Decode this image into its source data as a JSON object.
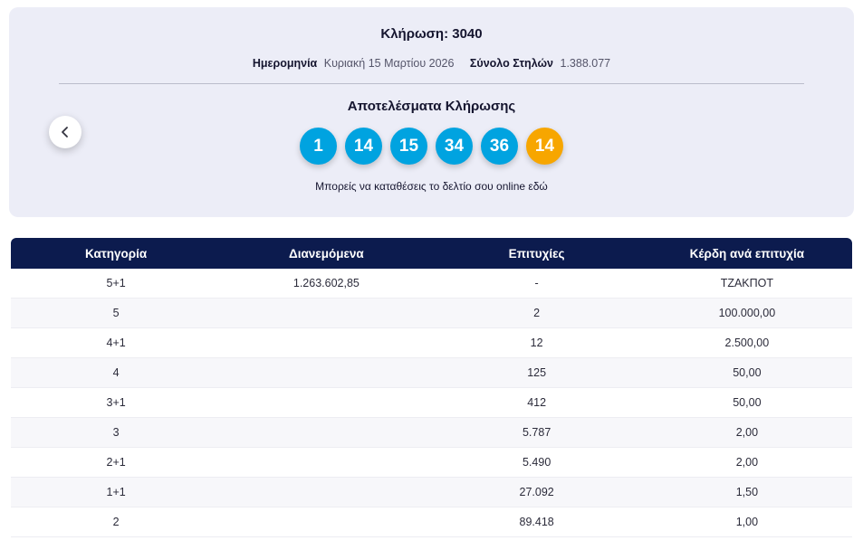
{
  "draw": {
    "title_label": "Κλήρωση:",
    "title_value": "3040",
    "date_label": "Ημερομηνία",
    "date_value": "Κυριακή 15 Μαρτίου 2026",
    "columns_label": "Σύνολο Στηλών",
    "columns_value": "1.388.077",
    "results_title": "Αποτελέσματα Κλήρωσης",
    "numbers": [
      "1",
      "14",
      "15",
      "34",
      "36"
    ],
    "bonus_number": "14",
    "online_text": "Μπορείς να καταθέσεις το δελτίο σου online εδώ"
  },
  "colors": {
    "card_bg": "#ecedf7",
    "number_circle": "#00a3e0",
    "bonus_circle": "#f7a600",
    "table_header_bg": "#0c1b4e"
  },
  "table": {
    "headers": [
      "Κατηγορία",
      "Διανεμόμενα",
      "Επιτυχίες",
      "Κέρδη ανά επιτυχία"
    ],
    "rows": [
      [
        "5+1",
        "1.263.602,85",
        "-",
        "ΤΖΑΚΠΟΤ"
      ],
      [
        "5",
        "",
        "2",
        "100.000,00"
      ],
      [
        "4+1",
        "",
        "12",
        "2.500,00"
      ],
      [
        "4",
        "",
        "125",
        "50,00"
      ],
      [
        "3+1",
        "",
        "412",
        "50,00"
      ],
      [
        "3",
        "",
        "5.787",
        "2,00"
      ],
      [
        "2+1",
        "",
        "5.490",
        "2,00"
      ],
      [
        "1+1",
        "",
        "27.092",
        "1,50"
      ],
      [
        "2",
        "",
        "89.418",
        "1,00"
      ]
    ]
  }
}
